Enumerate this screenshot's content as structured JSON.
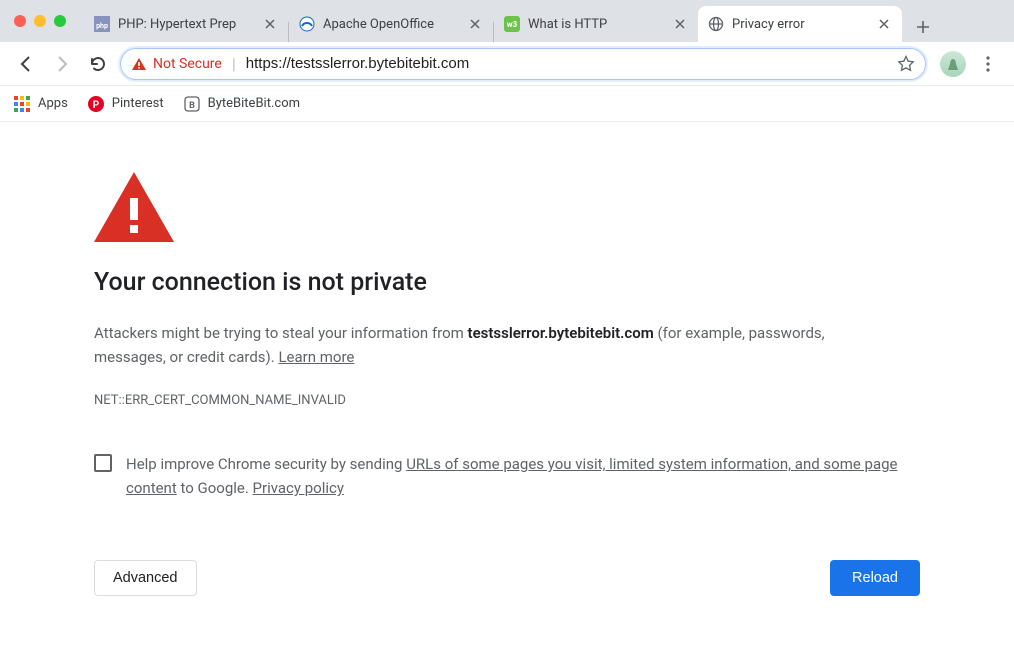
{
  "tabs": [
    {
      "title": "PHP: Hypertext Prep"
    },
    {
      "title": "Apache OpenOffice"
    },
    {
      "title": "What is HTTP"
    },
    {
      "title": "Privacy error"
    }
  ],
  "address": {
    "not_secure": "Not Secure",
    "url": "https://testsslerror.bytebitebit.com"
  },
  "bookmarks": {
    "apps": "Apps",
    "pinterest": "Pinterest",
    "bytebitebit": "ByteBiteBit.com"
  },
  "page": {
    "heading": "Your connection is not private",
    "desc_prefix": "Attackers might be trying to steal your information from ",
    "desc_site": "testsslerror.bytebitebit.com",
    "desc_suffix": " (for example, passwords, messages, or credit cards). ",
    "learn_more": "Learn more",
    "err_code": "NET::ERR_CERT_COMMON_NAME_INVALID",
    "optin_prefix": "Help improve Chrome security by sending ",
    "optin_link1": "URLs of some pages you visit, limited system information, and some page content",
    "optin_mid": " to Google. ",
    "optin_link2": "Privacy policy",
    "advanced": "Advanced",
    "reload": "Reload"
  }
}
